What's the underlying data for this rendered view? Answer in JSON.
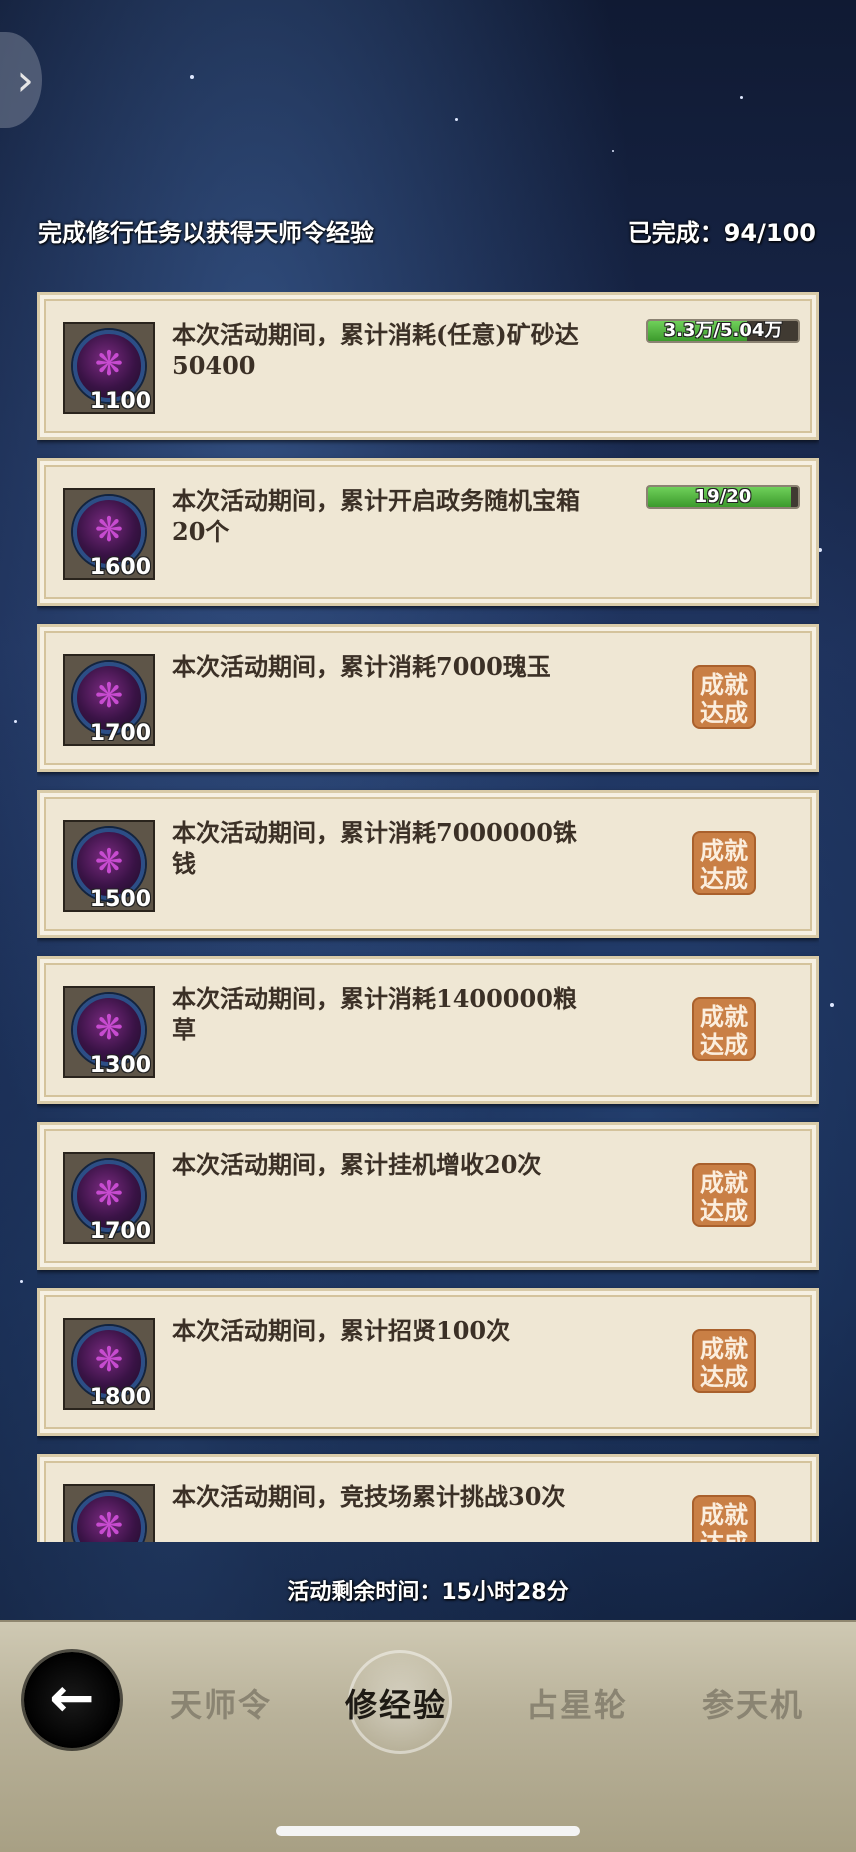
{
  "header": {
    "title": "完成修行任务以获得天师令经验",
    "progress_label": "已完成：94/100"
  },
  "tasks": [
    {
      "desc": "本次活动期间，累计消耗(任意)矿砂达50400",
      "reward": "1100",
      "progress_text": "3.3万/5.04万",
      "progress_fraction": 0.655,
      "done": false
    },
    {
      "desc": "本次活动期间，累计开启政务随机宝箱20个",
      "reward": "1600",
      "progress_text": "19/20",
      "progress_fraction": 0.95,
      "done": false
    },
    {
      "desc": "本次活动期间，累计消耗7000瑰玉",
      "reward": "1700",
      "status": "成就达成",
      "done": true
    },
    {
      "desc": "本次活动期间，累计消耗7000000铢钱",
      "reward": "1500",
      "status": "成就达成",
      "done": true
    },
    {
      "desc": "本次活动期间，累计消耗1400000粮草",
      "reward": "1300",
      "status": "成就达成",
      "done": true
    },
    {
      "desc": "本次活动期间，累计挂机增收20次",
      "reward": "1700",
      "status": "成就达成",
      "done": true
    },
    {
      "desc": "本次活动期间，累计招贤100次",
      "reward": "1800",
      "status": "成就达成",
      "done": true
    },
    {
      "desc": "本次活动期间，竞技场累计挑战30次",
      "reward": "",
      "status": "成就达成",
      "done": true
    }
  ],
  "timer": "活动剩余时间：15小时28分",
  "tabs": [
    {
      "label": "天师令",
      "active": false
    },
    {
      "label": "修经验",
      "active": true
    },
    {
      "label": "占星轮",
      "active": false
    },
    {
      "label": "参天机",
      "active": false
    }
  ],
  "icons": {
    "collapse": "chevron-right-icon",
    "back": "back-arrow-icon",
    "reward": "talisman-token-icon"
  },
  "colors": {
    "progress_fill": "#4caf3a",
    "stamp": "#c97f45",
    "card_bg": "#efe7d4"
  }
}
